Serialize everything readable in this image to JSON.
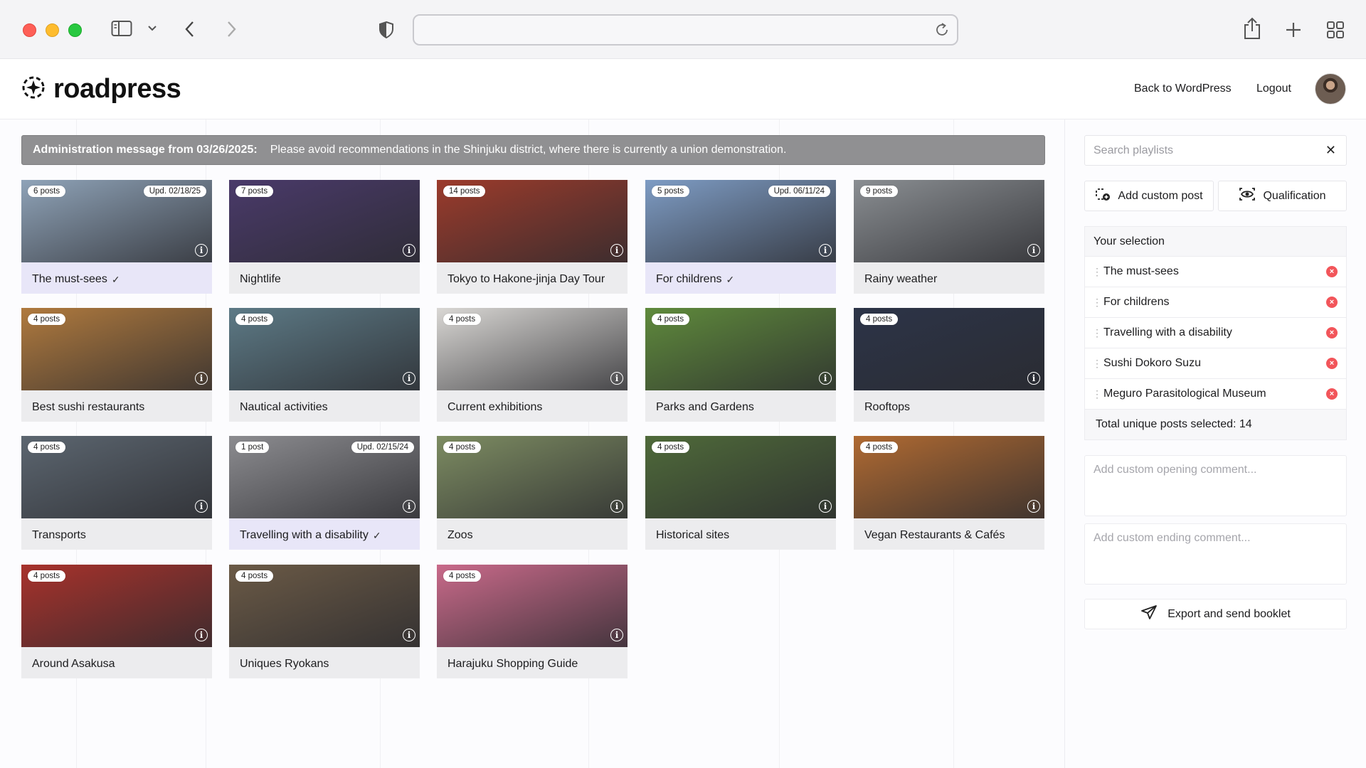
{
  "browser": {
    "url": "",
    "icons": [
      "sidebar-icon",
      "chevron-down-icon",
      "back-icon",
      "forward-icon",
      "shield-icon",
      "reload-icon",
      "share-icon",
      "new-tab-icon",
      "tab-overview-icon"
    ]
  },
  "header": {
    "logo_text": "roadpress",
    "nav": {
      "back": "Back to WordPress",
      "logout": "Logout"
    }
  },
  "admin_message": {
    "title": "Administration message from 03/26/2025:",
    "text": "Please avoid recommendations in the Shinjuku district, where there is currently a union demonstration."
  },
  "playlists": [
    {
      "title": "The must-sees",
      "posts": "6 posts",
      "updated": "Upd. 02/18/25",
      "selected": true,
      "theme": "#8fa3b8"
    },
    {
      "title": "Nightlife",
      "posts": "7 posts",
      "updated": "",
      "selected": false,
      "theme": "#4a3a6a"
    },
    {
      "title": "Tokyo to Hakone-jinja Day Tour",
      "posts": "14 posts",
      "updated": "",
      "selected": false,
      "theme": "#9c3b2c"
    },
    {
      "title": "For childrens",
      "posts": "5 posts",
      "updated": "Upd. 06/11/24",
      "selected": true,
      "theme": "#7e9cc4"
    },
    {
      "title": "Rainy weather",
      "posts": "9 posts",
      "updated": "",
      "selected": false,
      "theme": "#8a8e92"
    },
    {
      "title": "Best sushi restaurants",
      "posts": "4 posts",
      "updated": "",
      "selected": false,
      "theme": "#b07a3e"
    },
    {
      "title": "Nautical activities",
      "posts": "4 posts",
      "updated": "",
      "selected": false,
      "theme": "#5d7a86"
    },
    {
      "title": "Current exhibitions",
      "posts": "4 posts",
      "updated": "",
      "selected": false,
      "theme": "#d9d7d4"
    },
    {
      "title": "Parks and Gardens",
      "posts": "4 posts",
      "updated": "",
      "selected": false,
      "theme": "#5f8a3c"
    },
    {
      "title": "Rooftops",
      "posts": "4 posts",
      "updated": "",
      "selected": false,
      "theme": "#2c3448"
    },
    {
      "title": "Transports",
      "posts": "4 posts",
      "updated": "",
      "selected": false,
      "theme": "#5c6670"
    },
    {
      "title": "Travelling with a disability",
      "posts": "1 post",
      "updated": "Upd. 02/15/24",
      "selected": true,
      "theme": "#8c8c90"
    },
    {
      "title": "Zoos",
      "posts": "4 posts",
      "updated": "",
      "selected": false,
      "theme": "#7d8c62"
    },
    {
      "title": "Historical sites",
      "posts": "4 posts",
      "updated": "",
      "selected": false,
      "theme": "#4f6a3a"
    },
    {
      "title": "Vegan Restaurants & Cafés",
      "posts": "4 posts",
      "updated": "",
      "selected": false,
      "theme": "#b06a32"
    },
    {
      "title": "Around Asakusa",
      "posts": "4 posts",
      "updated": "",
      "selected": false,
      "theme": "#a8322c"
    },
    {
      "title": "Uniques Ryokans",
      "posts": "4 posts",
      "updated": "",
      "selected": false,
      "theme": "#6b5a46"
    },
    {
      "title": "Harajuku Shopping Guide",
      "posts": "4 posts",
      "updated": "",
      "selected": false,
      "theme": "#c96a8a"
    }
  ],
  "panel": {
    "search_placeholder": "Search playlists",
    "add_custom_post": "Add custom post",
    "qualification": "Qualification",
    "selection_title": "Your selection",
    "selection": [
      "The must-sees",
      "For childrens",
      "Travelling with a disability",
      "Sushi Dokoro Suzu",
      "Meguro Parasitological Museum"
    ],
    "total": "Total unique posts selected: 14",
    "opening_placeholder": "Add custom opening comment...",
    "ending_placeholder": "Add custom ending comment...",
    "export": "Export and send booklet"
  },
  "colors": {
    "accent_selected": "#e8e6f8",
    "remove": "#f2555a",
    "admin_banner": "#909092"
  }
}
